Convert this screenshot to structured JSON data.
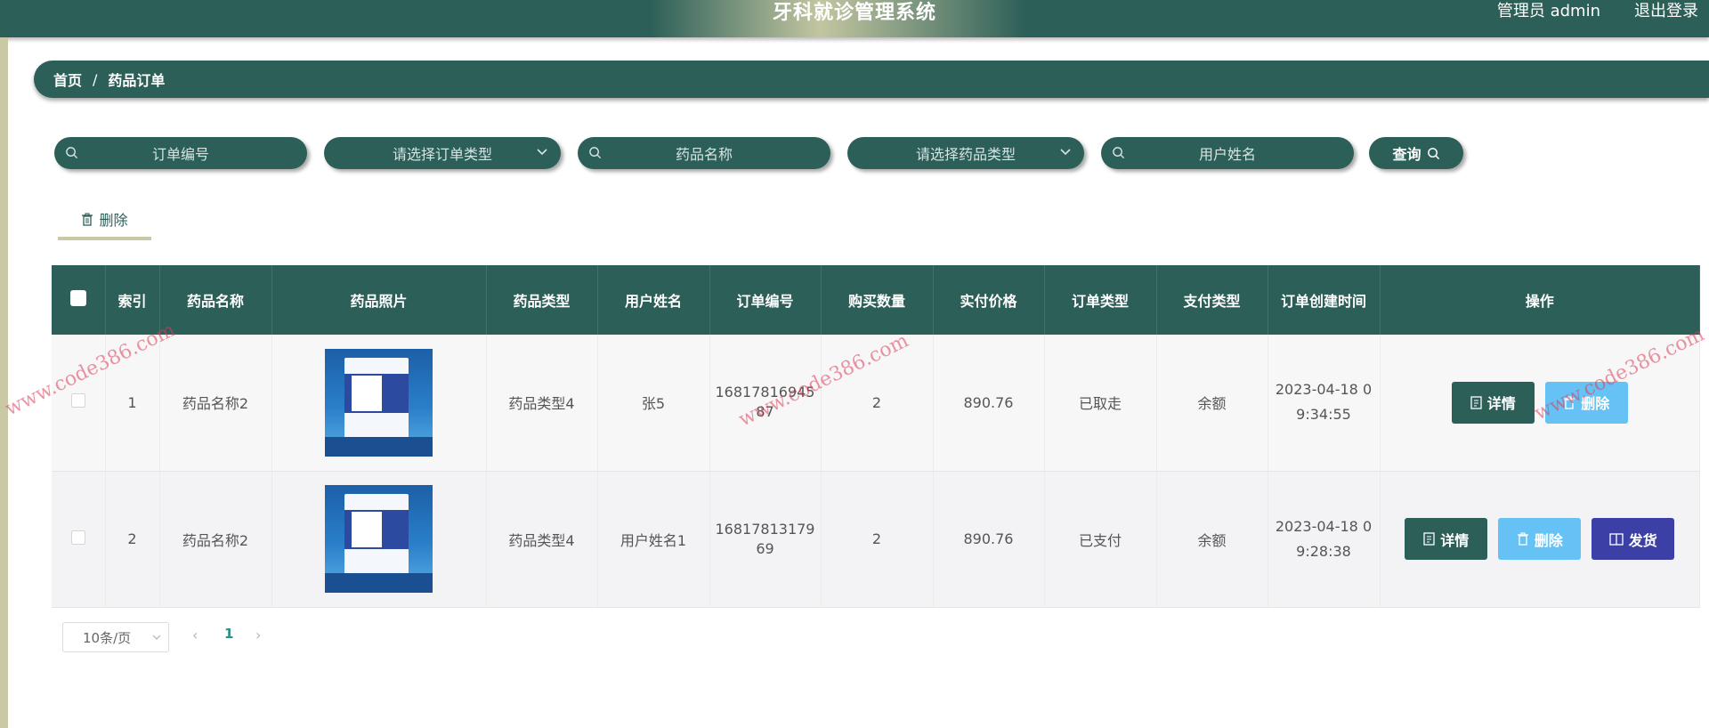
{
  "header": {
    "title": "牙科就诊管理系统",
    "user": "管理员 admin",
    "logout": "退出登录"
  },
  "breadcrumb": {
    "home": "首页",
    "separator": "/",
    "current": "药品订单"
  },
  "search": {
    "order_no": "订单编号",
    "order_type": "请选择订单类型",
    "drug_name": "药品名称",
    "drug_type": "请选择药品类型",
    "user_name": "用户姓名",
    "query": "查询"
  },
  "toolbar": {
    "delete": "删除"
  },
  "table": {
    "headers": [
      "索引",
      "药品名称",
      "药品照片",
      "药品类型",
      "用户姓名",
      "订单编号",
      "购买数量",
      "实付价格",
      "订单类型",
      "支付类型",
      "订单创建时间",
      "操作"
    ],
    "rows": [
      {
        "index": "1",
        "drug_name": "药品名称2",
        "drug_type": "药品类型4",
        "user_name": "张5",
        "order_no": "1681781694587",
        "quantity": "2",
        "price": "890.76",
        "order_type": "已取走",
        "pay_type": "余额",
        "created": "2023-04-18 09:34:55",
        "actions": {
          "detail": "详情",
          "delete": "删除"
        }
      },
      {
        "index": "2",
        "drug_name": "药品名称2",
        "drug_type": "药品类型4",
        "user_name": "用户姓名1",
        "order_no": "1681781317969",
        "quantity": "2",
        "price": "890.76",
        "order_type": "已支付",
        "pay_type": "余额",
        "created": "2023-04-18 09:28:38",
        "actions": {
          "detail": "详情",
          "delete": "删除",
          "ship": "发货"
        }
      }
    ]
  },
  "pagination": {
    "page_size": "10条/页",
    "current_page": "1"
  },
  "watermark": "www.code386.com",
  "colors": {
    "primary": "#2c5f58",
    "delete_button": "#66c2f4",
    "ship_button": "#3c3fa6",
    "accent": "#c9c9a6"
  }
}
